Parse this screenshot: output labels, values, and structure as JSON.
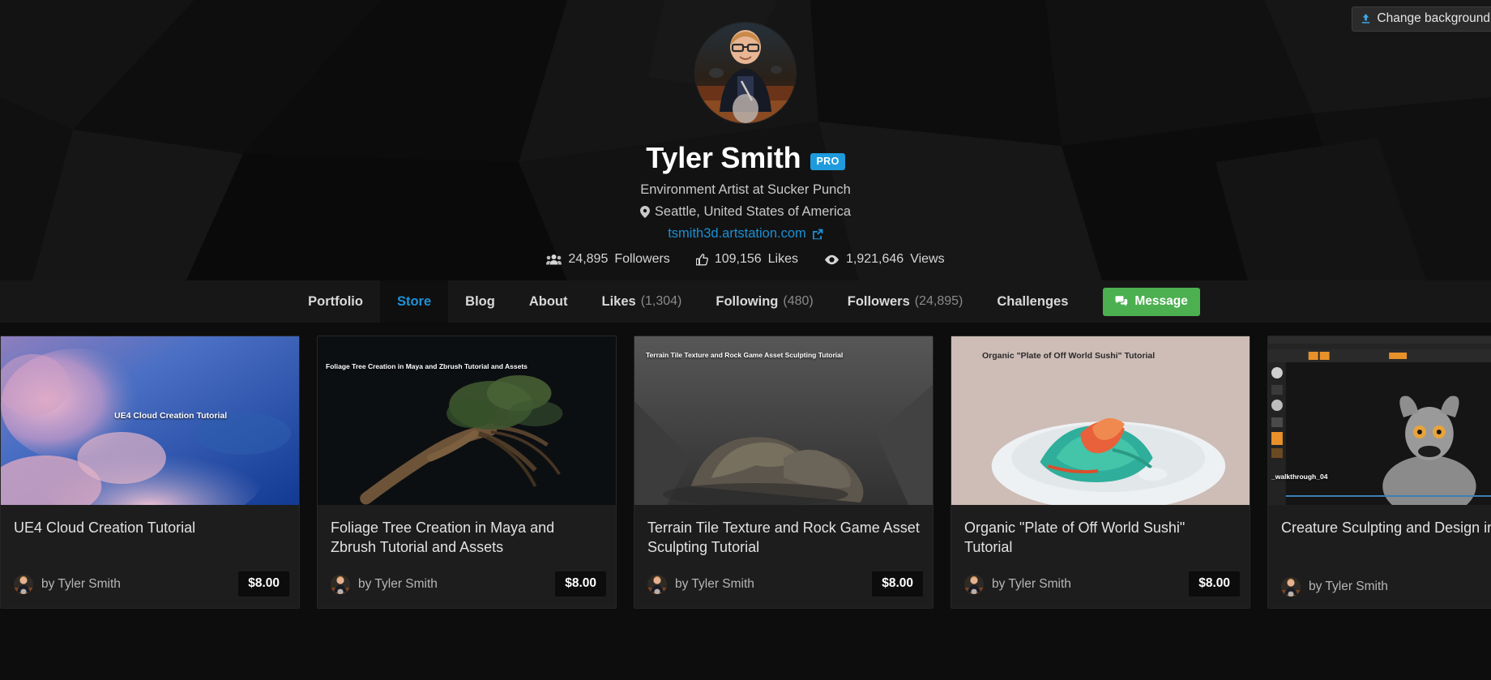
{
  "hero": {
    "change_background_label": "Change background",
    "upload_icon": "upload-icon"
  },
  "profile": {
    "avatar_alt": "user-avatar",
    "display_name": "Tyler Smith",
    "pro_badge": "PRO",
    "headline": "Environment Artist at Sucker Punch",
    "location": "Seattle, United States of America",
    "location_icon": "map-pin-icon",
    "website": "tsmith3d.artstation.com",
    "website_icon": "external-link-icon",
    "stats": [
      {
        "icon": "users-icon",
        "value": "24,895",
        "label": "Followers"
      },
      {
        "icon": "thumbs-up-icon",
        "value": "109,156",
        "label": "Likes"
      },
      {
        "icon": "eye-icon",
        "value": "1,921,646",
        "label": "Views"
      }
    ]
  },
  "nav": {
    "tabs": [
      {
        "label": "Portfolio",
        "count": "",
        "active": false
      },
      {
        "label": "Store",
        "count": "",
        "active": true
      },
      {
        "label": "Blog",
        "count": "",
        "active": false
      },
      {
        "label": "About",
        "count": "",
        "active": false
      },
      {
        "label": "Likes",
        "count": "(1,304)",
        "active": false
      },
      {
        "label": "Following",
        "count": "(480)",
        "active": false
      },
      {
        "label": "Followers",
        "count": "(24,895)",
        "active": false
      },
      {
        "label": "Challenges",
        "count": "",
        "active": false
      }
    ],
    "message_button": "Message",
    "message_icon": "chat-bubble-icon"
  },
  "store": {
    "cards": [
      {
        "title": "UE4 Cloud Creation Tutorial",
        "thumb_label": "UE4 Cloud Creation Tutorial",
        "author": "by Tyler Smith",
        "price": "$8.00"
      },
      {
        "title": "Foliage Tree Creation in Maya and Zbrush Tutorial and Assets",
        "thumb_label": "Foliage Tree Creation in Maya and Zbrush Tutorial and Assets",
        "author": "by Tyler Smith",
        "price": "$8.00"
      },
      {
        "title": "Terrain Tile Texture and Rock Game Asset Sculpting Tutorial",
        "thumb_label": "Terrain Tile Texture and Rock Game Asset Sculpting Tutorial",
        "author": "by Tyler Smith",
        "price": "$8.00"
      },
      {
        "title": "Organic \"Plate of Off World Sushi\" Tutorial",
        "thumb_label": "Organic \"Plate of Off World Sushi\" Tutorial",
        "author": "by Tyler Smith",
        "price": "$8.00"
      },
      {
        "title": "Creature Sculpting and Design in Z",
        "thumb_label": "_walkthrough_04",
        "author": "by Tyler Smith",
        "price": ""
      }
    ]
  },
  "colors": {
    "accent_blue": "#1f92d6",
    "pro_blue": "#1e9bdd",
    "message_green": "#4caf50",
    "page_bg": "#0d0d0d",
    "nav_bg": "#171717",
    "card_bg": "#1d1d1d"
  }
}
